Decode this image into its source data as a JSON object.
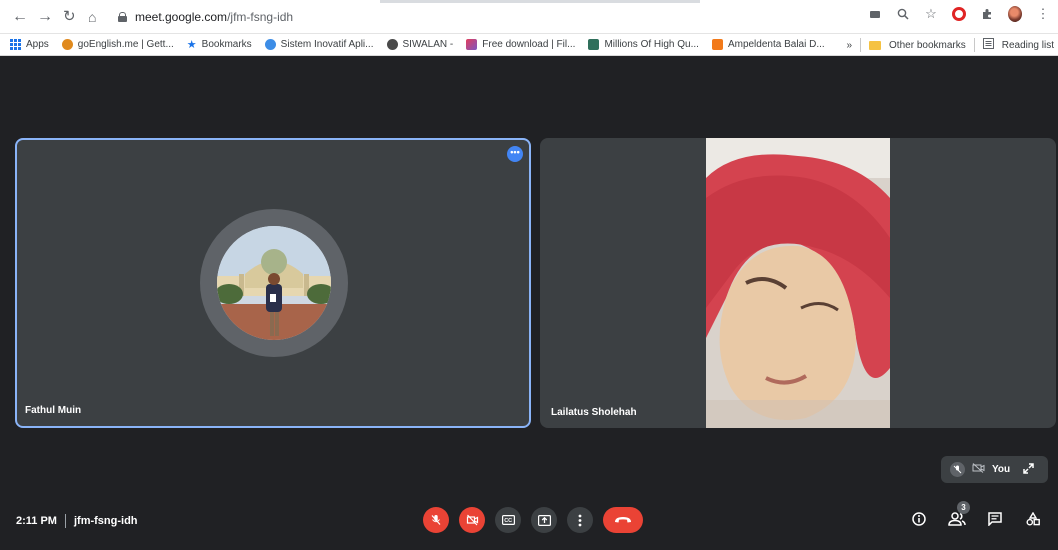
{
  "browser": {
    "url_host": "meet.google.com",
    "url_path": "/jfm-fsng-idh"
  },
  "bookmarks": [
    {
      "label": "Apps",
      "color": "#1a73e8"
    },
    {
      "label": "goEnglish.me | Gett...",
      "color": "#e08a1e"
    },
    {
      "label": "Bookmarks",
      "color": "#1a73e8"
    },
    {
      "label": "Sistem Inovatif Apli...",
      "color": "#3d8de6"
    },
    {
      "label": "SIWALAN -",
      "color": "#4a4a4a"
    },
    {
      "label": "Free download | Fil...",
      "color": "#e23d5c"
    },
    {
      "label": "Millions Of High Qu...",
      "color": "#2f6f5b"
    },
    {
      "label": "Ampeldenta Balai D...",
      "color": "#f27a1a"
    }
  ],
  "bookmarks_right": {
    "more": "»",
    "other": "Other bookmarks",
    "reading": "Reading list"
  },
  "participants": [
    {
      "name": "Fathul Muin"
    },
    {
      "name": "Lailatus Sholehah"
    }
  ],
  "self_view": {
    "label": "You"
  },
  "footer": {
    "time": "2:11 PM",
    "meeting_code": "jfm-fsng-idh"
  },
  "people_count": "3",
  "colors": {
    "background": "#202124",
    "tile": "#3c4043",
    "active_border": "#8ab4f8",
    "danger": "#ea4335"
  }
}
